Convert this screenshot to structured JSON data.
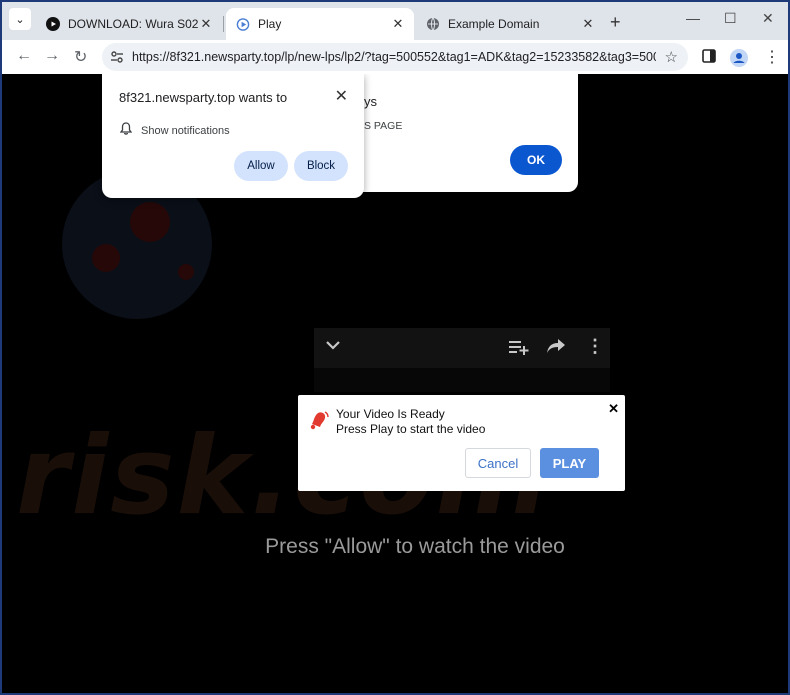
{
  "tabs": [
    {
      "title": "DOWNLOAD: Wura S02 (Episo",
      "active": false,
      "icon": "youtube-icon"
    },
    {
      "title": "Play",
      "active": true,
      "icon": "play-favicon-icon"
    },
    {
      "title": "Example Domain",
      "active": false,
      "icon": "globe-icon"
    }
  ],
  "toolbar": {
    "url": "https://8f321.newsparty.top/lp/new-lps/lp2/?tag=500552&tag1=ADK&tag2=15233582&tag3=500552..."
  },
  "permission_prompt": {
    "title": "8f321.newsparty.top wants to",
    "permission": "Show notifications",
    "allow_label": "Allow",
    "block_label": "Block"
  },
  "alert_dialog": {
    "title_visible": "ys",
    "message_visible": "S PAGE",
    "ok_label": "OK"
  },
  "video_dialog": {
    "line1": "Your Video Is Ready",
    "line2": "Press Play to start the video",
    "cancel_label": "Cancel",
    "play_label": "PLAY"
  },
  "page": {
    "main_text": "Press \"Allow\" to watch the video",
    "watermark": "risk.com"
  },
  "colors": {
    "accent_blue": "#0b57d0",
    "chip_blue": "#d3e3fd",
    "play_button": "#5b8fe0",
    "page_bg": "#000000"
  }
}
